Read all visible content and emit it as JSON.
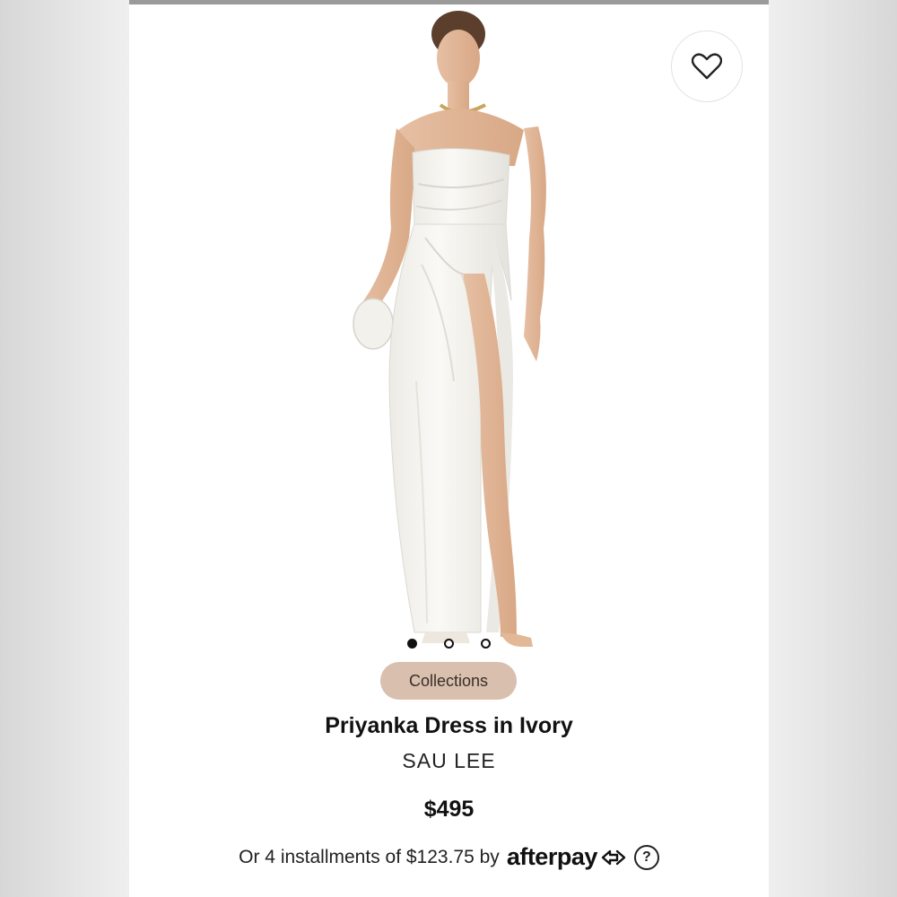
{
  "product": {
    "chip_label": "Collections",
    "title": "Priyanka Dress in Ivory",
    "brand": "SAU LEE",
    "price": "$495",
    "installment_prefix": "Or 4 installments of $123.75 by",
    "installment_provider": "afterpay",
    "help_symbol": "?"
  },
  "gallery": {
    "image_count": 3,
    "active_index": 0
  },
  "icons": {
    "wishlist": "heart-icon",
    "afterpay": "afterpay-arrows-icon",
    "help": "question-circle-icon"
  },
  "colors": {
    "chip_bg": "#d8bfae",
    "text": "#111111",
    "dress": "#f6f4ef"
  }
}
